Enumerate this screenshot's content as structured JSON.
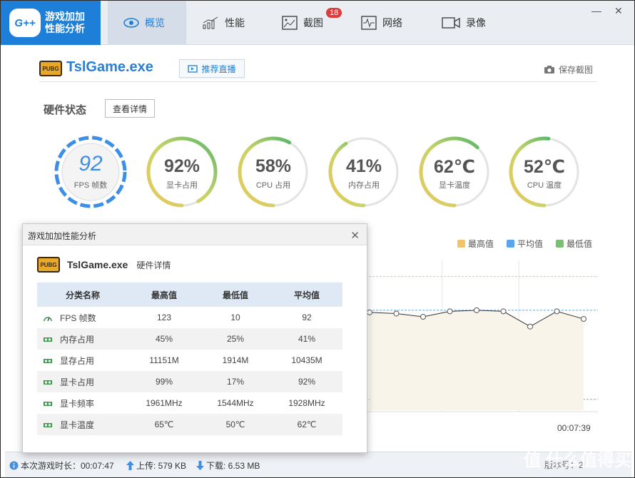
{
  "app": {
    "logo_badge": "G++",
    "logo_line1": "游戏加加",
    "logo_line2": "性能分析",
    "accent_color": "#1e7fd8"
  },
  "nav": {
    "tabs": [
      {
        "label": "概览",
        "icon": "eye-icon",
        "active": true
      },
      {
        "label": "性能",
        "icon": "bar-chart-icon"
      },
      {
        "label": "截图",
        "icon": "image-icon",
        "badge": "18"
      },
      {
        "label": "网络",
        "icon": "pulse-icon"
      },
      {
        "label": "录像",
        "icon": "video-camera-icon"
      }
    ]
  },
  "window_controls": {
    "minimize": "—",
    "close": "✕"
  },
  "game": {
    "logo_text": "PUBG",
    "name": "TslGame.exe",
    "live_button": "推荐直播",
    "save_screenshot": "保存截图"
  },
  "hardware": {
    "title": "硬件状态",
    "detail_button": "查看详情",
    "gauges": [
      {
        "value": "92",
        "label": "FPS 帧数",
        "type": "fps"
      },
      {
        "value": "92%",
        "label": "显卡占用",
        "level": 0.92
      },
      {
        "value": "58%",
        "label": "CPU 占用",
        "level": 0.58
      },
      {
        "value": "41%",
        "label": "内存占用",
        "level": 0.41
      },
      {
        "value": "62℃",
        "label": "显卡温度",
        "level": 0.62
      },
      {
        "value": "52℃",
        "label": "CPU 温度",
        "level": 0.52
      }
    ]
  },
  "legend": [
    {
      "label": "最高值",
      "color": "#f0c36d"
    },
    {
      "label": "平均值",
      "color": "#5aa6ee"
    },
    {
      "label": "最低值",
      "color": "#7bbf72"
    }
  ],
  "chart_data": {
    "type": "line",
    "x_end_label": "00:07:39",
    "values": [
      90,
      89,
      86,
      91,
      92,
      91,
      77,
      91,
      84
    ],
    "max_line": 123,
    "avg_line": 92,
    "min_line": 10
  },
  "dialog": {
    "title": "游戏加加性能分析",
    "close": "✕",
    "game_name": "TslGame.exe",
    "subtitle": "硬件详情",
    "columns": [
      "分类名称",
      "最高值",
      "最低值",
      "平均值"
    ],
    "rows": [
      {
        "name": "FPS 帧数",
        "icon": "gauge-icon",
        "max": "123",
        "min": "10",
        "avg": "92"
      },
      {
        "name": "内存占用",
        "icon": "memory-icon",
        "max": "45%",
        "min": "25%",
        "avg": "41%"
      },
      {
        "name": "显存占用",
        "icon": "vram-icon",
        "max": "11151M",
        "min": "1914M",
        "avg": "10435M"
      },
      {
        "name": "显卡占用",
        "icon": "gpu-icon",
        "max": "99%",
        "min": "17%",
        "avg": "92%"
      },
      {
        "name": "显卡频率",
        "icon": "gpu-icon",
        "max": "1961MHz",
        "min": "1544MHz",
        "avg": "1928MHz"
      },
      {
        "name": "显卡温度",
        "icon": "gpu-icon",
        "max": "65℃",
        "min": "50℃",
        "avg": "62℃"
      }
    ]
  },
  "status_bar": {
    "session": "本次游戏时长：00:07:47",
    "upload": "上传: 579 KB",
    "download": "下载: 6.53 MB",
    "version": "版本号：2"
  },
  "watermark": "值 什么值得买"
}
